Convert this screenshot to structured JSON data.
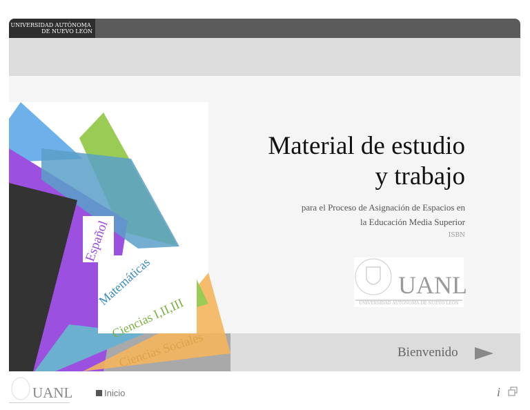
{
  "header": {
    "logo_line1": "UNIVERSIDAD AUTÓNOMA",
    "logo_line2": "DE NUEVO LEÓN"
  },
  "cover": {
    "title_line1": "Material de estudio",
    "title_line2": "y trabajo",
    "subtitle_line1": "para el Proceso de Asignación de Espacios en",
    "subtitle_line2": "la Educación Media Superior",
    "isbn": "ISBN",
    "subjects": [
      "Español",
      "Matemáticas",
      "Ciencias I,II,III",
      "Ciencias Sociales"
    ],
    "logo_text": "UANL",
    "logo_caption": "UNIVERSIDAD AUTÓNOMA DE NUEVO LEÓN"
  },
  "nav": {
    "welcome": "Bienvenido"
  },
  "footer": {
    "logo_text": "UANL",
    "home": "Inicio",
    "info": "i"
  }
}
